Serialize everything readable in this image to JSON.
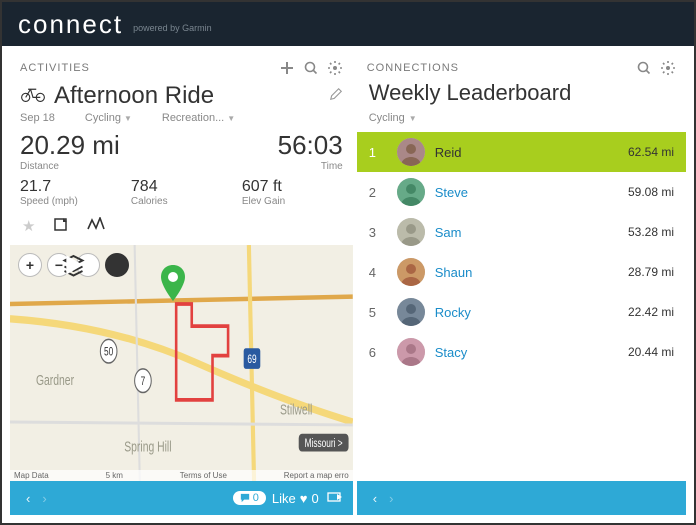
{
  "brand": {
    "name": "connect",
    "sub": "powered by Garmin"
  },
  "activities": {
    "header": "ACTIVITIES",
    "title": "Afternoon Ride",
    "date": "Sep 18",
    "sport": "Cycling",
    "category": "Recreation...",
    "distance": {
      "value": "20.29 mi",
      "label": "Distance"
    },
    "time": {
      "value": "56:03",
      "label": "Time"
    },
    "speed": {
      "value": "21.7",
      "label": "Speed (mph)"
    },
    "calories": {
      "value": "784",
      "label": "Calories"
    },
    "elev": {
      "value": "607 ft",
      "label": "Elev Gain"
    },
    "map": {
      "labels": {
        "gardner": "Gardner",
        "springhill": "Spring Hill",
        "stilwell": "Stilwell"
      },
      "hw": {
        "fifty": "50",
        "seven": "7",
        "sixtynine": "69"
      },
      "badges": {
        "missouri": "Missouri >"
      },
      "footer": {
        "left": "Map Data",
        "scale": "5 km",
        "mid": "Terms of Use",
        "right": "Report a map erro"
      }
    },
    "bottom": {
      "comments": "0",
      "like_label": "Like",
      "like_count": "0"
    }
  },
  "connections": {
    "header": "CONNECTIONS",
    "title": "Weekly Leaderboard",
    "filter": "Cycling",
    "rows": [
      {
        "rank": "1",
        "name": "Reid",
        "dist": "62.54 mi",
        "hl": true
      },
      {
        "rank": "2",
        "name": "Steve",
        "dist": "59.08 mi",
        "hl": false
      },
      {
        "rank": "3",
        "name": "Sam",
        "dist": "53.28 mi",
        "hl": false
      },
      {
        "rank": "4",
        "name": "Shaun",
        "dist": "28.79 mi",
        "hl": false
      },
      {
        "rank": "5",
        "name": "Rocky",
        "dist": "22.42 mi",
        "hl": false
      },
      {
        "rank": "6",
        "name": "Stacy",
        "dist": "20.44 mi",
        "hl": false
      }
    ]
  }
}
